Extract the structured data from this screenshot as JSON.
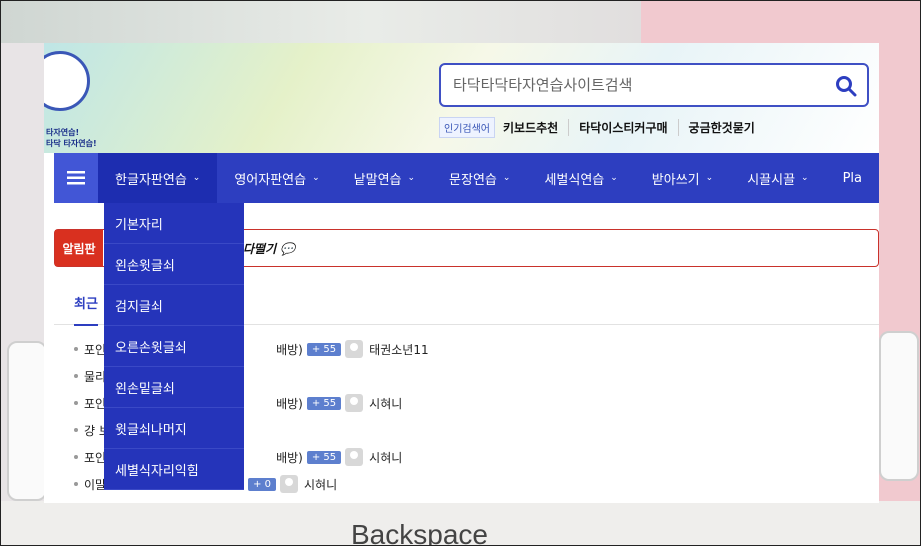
{
  "background": {
    "keyboard_key_label": "Backspace"
  },
  "logo": {
    "line1": "타자연습!",
    "line2": "타닥 타자연습!"
  },
  "search": {
    "placeholder": "타닥타닥타자연습사이트검색",
    "button_icon": "search-icon"
  },
  "popular": {
    "tag": "인기검색어",
    "keywords": [
      "키보드추천",
      "타닥이스티커구매",
      "궁금한것묻기"
    ]
  },
  "nav": {
    "menu_icon": "hamburger-icon",
    "items": [
      "한글자판연습",
      "영어자판연습",
      "낱말연습",
      "문장연습",
      "세벌식연습",
      "받아쓰기",
      "시끌시끌",
      "Pla"
    ]
  },
  "dropdown": {
    "items": [
      "기본자리",
      "왼손윗글쇠",
      "검지글쇠",
      "오른손윗글쇠",
      "왼손밑글쇠",
      "윗글쇠나머지",
      "세별식자리익힘"
    ]
  },
  "notice": {
    "label": "알림판",
    "message": "다떨기 💬"
  },
  "tabs": {
    "active": "최근"
  },
  "posts": [
    {
      "pre": "포인",
      "suffix": "배방)",
      "count": "+ 55",
      "user": "태권소년11"
    },
    {
      "pre": "물리",
      "suffix": "",
      "count": "",
      "user": ""
    },
    {
      "pre": "포인",
      "suffix": "배방)",
      "count": "+ 55",
      "user": "시혀니"
    },
    {
      "pre": "걍 보",
      "suffix": "",
      "count": "",
      "user": ""
    },
    {
      "pre": "포인",
      "suffix": "배방)",
      "count": "+ 55",
      "user": "시혀니"
    },
    {
      "pre": "이말",
      "suffix": "…",
      "count": "+ 0",
      "user": "시혀니"
    }
  ]
}
